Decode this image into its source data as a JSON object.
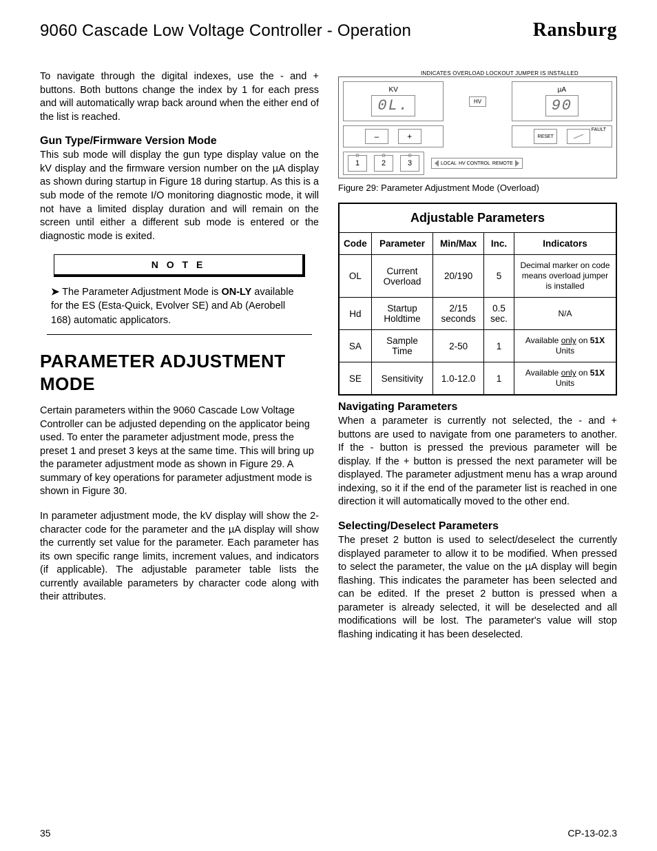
{
  "header": {
    "title": "9060 Cascade Low Voltage Controller - Operation",
    "brand": "Ransburg"
  },
  "left": {
    "intro": "To navigate through the digital indexes, use the - and + buttons.  Both buttons change the index by 1 for each press and will automatically wrap back around when the either end of the list is reached.",
    "h2a": "Gun Type/Firmware Version Mode",
    "p2": "This sub mode will display the gun type display value on the kV display and the firmware version number on the µA display as shown during startup in Figure 18 during startup.  As this is a sub mode of the remote I/O monitoring diagnostic mode, it will not have a limited display duration and will remain on the screen until either a different sub mode is entered or the diagnostic mode is exited.",
    "note_label": "N O T E",
    "note_body_pre": "The Parameter Adjustment Mode is ",
    "note_body_bold": "ON-LY",
    "note_body_post": " available for the ES (Esta-Quick, Evolver SE) and Ab (Aerobell 168) automatic applicators.",
    "h1": "PARAMETER ADJUSTMENT MODE",
    "p3": "Certain parameters within the 9060 Cascade Low Voltage Controller can be adjusted depending on the applicator being used.  To enter the parameter adjustment mode, press the preset 1 and preset 3 keys at the same  time. This will bring up the parameter adjustment mode as shown in Figure 29.  A summary of key operations for parameter adjustment mode is shown in Figure 30.",
    "p4": "In parameter adjustment mode, the kV display will show the 2-character code for the parameter and the µA display will show the currently set value for the parameter.  Each parameter has its own specific range limits, increment values, and indicators (if applicable).  The adjustable parameter table lists the currently available parameters by character code along with their attributes."
  },
  "figure": {
    "indicates": "INDICATES OVERLOAD LOCKOUT JUMPER IS INSTALLED",
    "kv_label": "KV",
    "ua_label": "µA",
    "hv_label": "HV",
    "seg_left": "0L.",
    "seg_right": "90",
    "minus": "–",
    "plus": "+",
    "reset": "RESET",
    "fault": "FAULT",
    "local": "LOCAL",
    "remote": "REMOTE",
    "hv_control": "HV CONTROL",
    "presets": [
      "1",
      "2",
      "3"
    ],
    "caption": "Figure 29: Parameter Adjustment Mode (Overload)"
  },
  "table": {
    "title": "Adjustable Parameters",
    "headers": [
      "Code",
      "Parameter",
      "Min/Max",
      "Inc.",
      "Indicators"
    ],
    "rows": [
      {
        "code": "OL",
        "param": "Current Overload",
        "minmax": "20/190",
        "inc": "5",
        "ind": "Decimal marker on code means overload jumper is installed"
      },
      {
        "code": "Hd",
        "param": "Startup Holdtime",
        "minmax": "2/15 seconds",
        "inc": "0.5 sec.",
        "ind": "N/A"
      },
      {
        "code": "SA",
        "param": "Sample Time",
        "minmax": "2-50",
        "inc": "1",
        "ind_pre": "Available ",
        "ind_u": "only",
        "ind_post": " on ",
        "ind_b": "51X",
        "ind_tail": " Units"
      },
      {
        "code": "SE",
        "param": "Sensitivity",
        "minmax": "1.0-12.0",
        "inc": "1",
        "ind_pre": "Available ",
        "ind_u": "only",
        "ind_post": " on ",
        "ind_b": "51X",
        "ind_tail": " Units"
      }
    ]
  },
  "right": {
    "h2a": "Navigating Parameters",
    "p1": "When a parameter is currently not selected, the - and + buttons are used to navigate from one parameters to another.  If the - button is pressed the previous parameter will be display. If the + button is pressed the next parameter will be displayed.  The parameter adjustment menu has a wrap around indexing, so it if the end of the parameter list is reached in one direction it will automatically moved to the other end.",
    "h2b": "Selecting/Deselect Parameters",
    "p2": "The preset 2 button is used to select/deselect the currently displayed parameter to allow it to be modified.  When pressed to select the parameter, the value on the µA display will begin flashing.  This indicates the parameter has been selected and can be edited.  If the preset 2 button is pressed when a parameter is already selected, it will be deselected and all modifications will be lost.  The parameter's value will stop flashing indicating it has been deselected."
  },
  "footer": {
    "page": "35",
    "doc": "CP-13-02.3"
  }
}
